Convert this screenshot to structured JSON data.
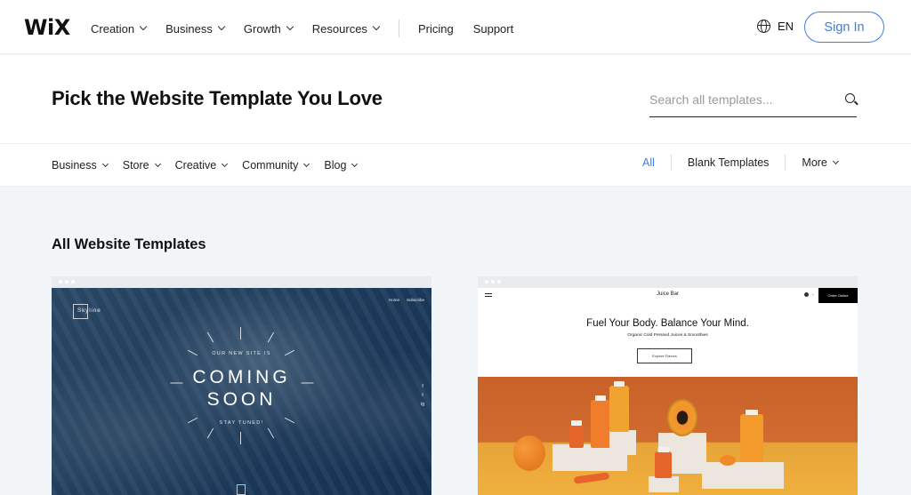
{
  "topnav": {
    "logo": "WiX",
    "items": [
      {
        "label": "Creation",
        "has_dropdown": true
      },
      {
        "label": "Business",
        "has_dropdown": true
      },
      {
        "label": "Growth",
        "has_dropdown": true
      },
      {
        "label": "Resources",
        "has_dropdown": true
      }
    ],
    "links": [
      {
        "label": "Pricing"
      },
      {
        "label": "Support"
      }
    ],
    "language": {
      "icon": "globe-icon",
      "label": "EN"
    },
    "sign_in": "Sign In"
  },
  "hero": {
    "title": "Pick the Website Template You Love",
    "search": {
      "placeholder": "Search all templates...",
      "value": "",
      "icon": "search-icon"
    }
  },
  "categories": {
    "left": [
      {
        "label": "Business"
      },
      {
        "label": "Store"
      },
      {
        "label": "Creative"
      },
      {
        "label": "Community"
      },
      {
        "label": "Blog"
      }
    ],
    "right": {
      "all": "All",
      "blank": "Blank Templates",
      "more": "More"
    },
    "active": "All",
    "accent_color": "#3d7de0"
  },
  "section": {
    "title": "All Website Templates"
  },
  "templates": [
    {
      "name": "Skyline",
      "preview": {
        "logo_text": "Skyline",
        "nav": [
          "Home",
          "Subscribe"
        ],
        "kicker": "OUR NEW SITE IS",
        "headline_line1": "COMING",
        "headline_line2": "SOON",
        "tagline": "STAY TUNED!",
        "social": [
          "f",
          "t",
          "ig"
        ]
      }
    },
    {
      "name": "Juice Bar",
      "preview": {
        "brand": "Juice Bar",
        "cta_top": "Order Online",
        "headline": "Fuel Your Body. Balance Your Mind.",
        "subheadline": "Organic Cold Pressed Juices & Smoothies",
        "button": "Explore Flavors"
      }
    }
  ]
}
